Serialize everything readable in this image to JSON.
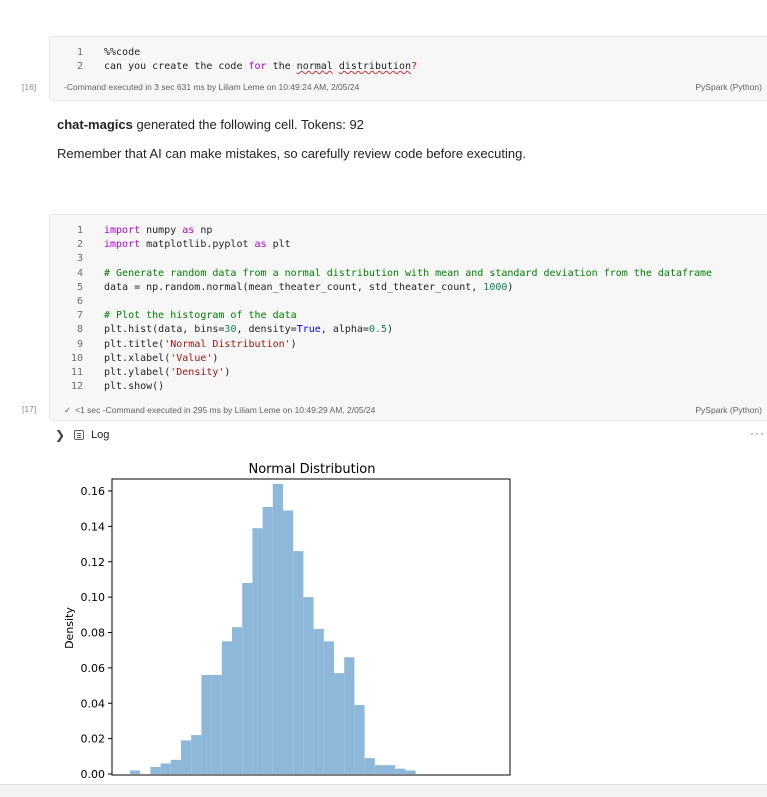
{
  "cell16": {
    "exec_count": "[16]",
    "lines": [
      {
        "n": "1",
        "parts": [
          {
            "t": "%%code",
            "c": ""
          }
        ]
      },
      {
        "n": "2",
        "parts": [
          {
            "t": "can you create the code ",
            "c": ""
          },
          {
            "t": "for",
            "c": "kw"
          },
          {
            "t": " the ",
            "c": ""
          },
          {
            "t": "normal",
            "c": "squiggle"
          },
          {
            "t": " ",
            "c": ""
          },
          {
            "t": "distribution",
            "c": "squiggle"
          },
          {
            "t": "?",
            "c": "str"
          }
        ]
      }
    ],
    "status": "-Command executed in 3 sec 631 ms by Liliam Leme on 10:49:24 AM, 2/05/24",
    "language": "PySpark (Python)"
  },
  "magic": {
    "name": "chat-magics",
    "rest": " generated the following cell. Tokens: 92",
    "warning": "Remember that AI can make mistakes, so carefully review code before executing."
  },
  "cell17": {
    "exec_count": "[17]",
    "lines": [
      {
        "n": "1",
        "parts": [
          {
            "t": "import",
            "c": "kw"
          },
          {
            "t": " numpy ",
            "c": ""
          },
          {
            "t": "as",
            "c": "kw"
          },
          {
            "t": " np",
            "c": ""
          }
        ]
      },
      {
        "n": "2",
        "parts": [
          {
            "t": "import",
            "c": "kw"
          },
          {
            "t": " matplotlib.pyplot ",
            "c": ""
          },
          {
            "t": "as",
            "c": "kw"
          },
          {
            "t": " plt",
            "c": ""
          }
        ]
      },
      {
        "n": "3",
        "parts": []
      },
      {
        "n": "4",
        "parts": [
          {
            "t": "# Generate random data from a normal distribution with mean and standard deviation from the dataframe",
            "c": "cm"
          }
        ]
      },
      {
        "n": "5",
        "parts": [
          {
            "t": "data = np.random.normal(mean_theater_count, std_theater_count, ",
            "c": ""
          },
          {
            "t": "1000",
            "c": "num"
          },
          {
            "t": ")",
            "c": ""
          }
        ]
      },
      {
        "n": "6",
        "parts": []
      },
      {
        "n": "7",
        "parts": [
          {
            "t": "# Plot the histogram of the data",
            "c": "cm"
          }
        ]
      },
      {
        "n": "8",
        "parts": [
          {
            "t": "plt.hist(data, bins=",
            "c": ""
          },
          {
            "t": "30",
            "c": "num"
          },
          {
            "t": ", density=",
            "c": ""
          },
          {
            "t": "True",
            "c": "kw2"
          },
          {
            "t": ", alpha=",
            "c": ""
          },
          {
            "t": "0.5",
            "c": "num"
          },
          {
            "t": ")",
            "c": ""
          }
        ]
      },
      {
        "n": "9",
        "parts": [
          {
            "t": "plt.title(",
            "c": ""
          },
          {
            "t": "'Normal Distribution'",
            "c": "str"
          },
          {
            "t": ")",
            "c": ""
          }
        ]
      },
      {
        "n": "10",
        "parts": [
          {
            "t": "plt.xlabel(",
            "c": ""
          },
          {
            "t": "'Value'",
            "c": "str"
          },
          {
            "t": ")",
            "c": ""
          }
        ]
      },
      {
        "n": "11",
        "parts": [
          {
            "t": "plt.ylabel(",
            "c": ""
          },
          {
            "t": "'Density'",
            "c": "str"
          },
          {
            "t": ")",
            "c": ""
          }
        ]
      },
      {
        "n": "12",
        "parts": [
          {
            "t": "plt.show()",
            "c": ""
          }
        ]
      }
    ],
    "status": "<1 sec -Command executed in 295 ms by Liliam Leme on 10:49:29 AM, 2/05/24",
    "language": "PySpark (Python)"
  },
  "log": {
    "label": "Log"
  },
  "colors": {
    "bar": "#8db8d9",
    "cell_bg": "#f7f7f7"
  },
  "chart_data": {
    "type": "bar",
    "title": "Normal Distribution",
    "ylabel": "Density",
    "ylim": [
      0,
      0.17
    ],
    "yticks": [
      "0.00",
      "0.02",
      "0.04",
      "0.06",
      "0.08",
      "0.10",
      "0.12",
      "0.14",
      "0.16"
    ],
    "values": [
      0.002,
      0.0,
      0.004,
      0.006,
      0.008,
      0.019,
      0.022,
      0.056,
      0.056,
      0.075,
      0.083,
      0.108,
      0.139,
      0.151,
      0.164,
      0.149,
      0.126,
      0.1,
      0.082,
      0.075,
      0.057,
      0.066,
      0.039,
      0.009,
      0.005,
      0.005,
      0.003,
      0.002
    ]
  }
}
